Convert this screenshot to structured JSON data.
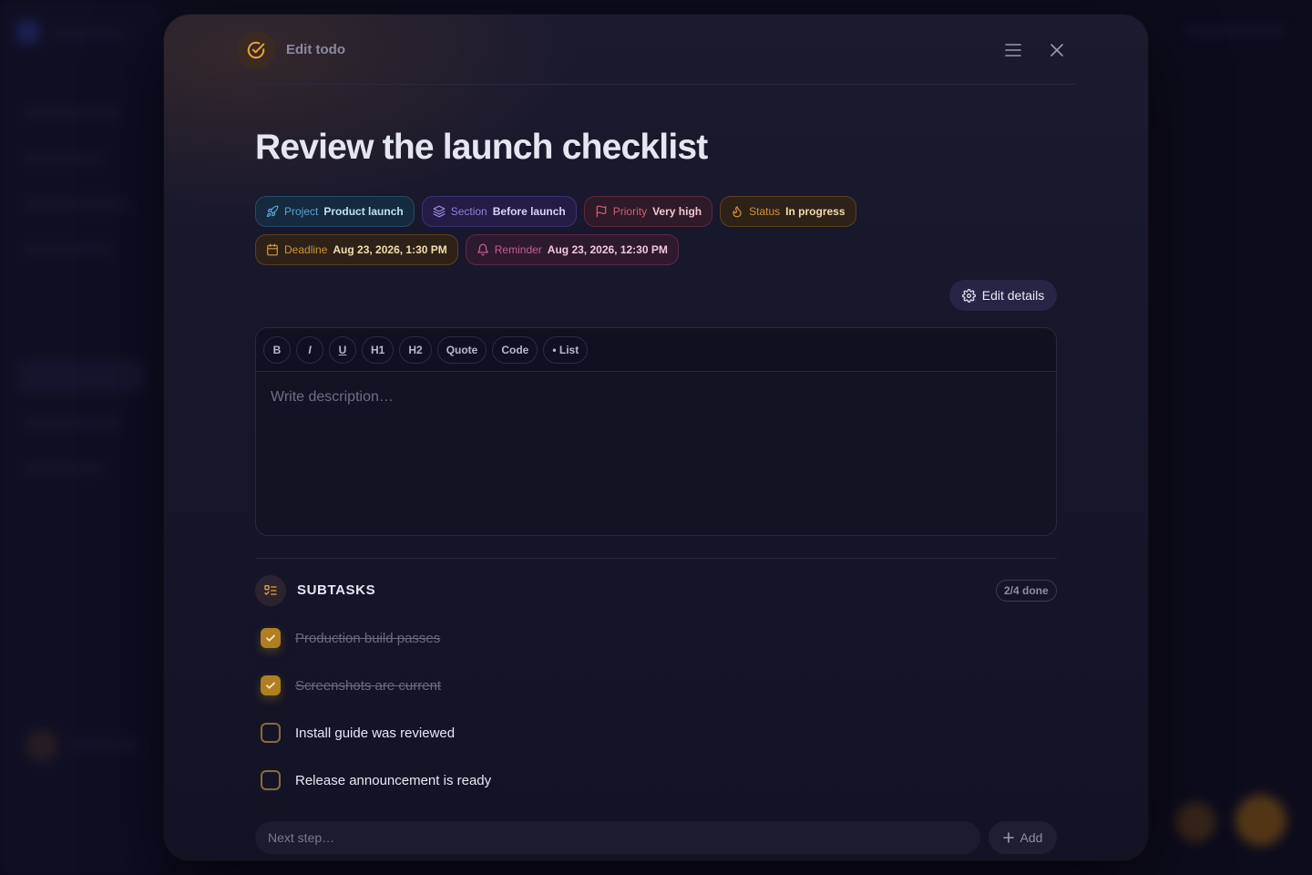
{
  "header": {
    "title": "Edit todo"
  },
  "todo": {
    "title": "Review the launch checklist"
  },
  "chips": {
    "project": {
      "key": "Project",
      "value": "Product launch"
    },
    "section": {
      "key": "Section",
      "value": "Before launch"
    },
    "priority": {
      "key": "Priority",
      "value": "Very high"
    },
    "status": {
      "key": "Status",
      "value": "In progress"
    },
    "deadline": {
      "key": "Deadline",
      "value": "Aug 23, 2026, 1:30 PM"
    },
    "reminder": {
      "key": "Reminder",
      "value": "Aug 23, 2026, 12:30 PM"
    }
  },
  "edit_details_label": "Edit details",
  "editor": {
    "toolbar": [
      "B",
      "I",
      "U",
      "H1",
      "H2",
      "Quote",
      "Code",
      "• List"
    ],
    "placeholder": "Write description…",
    "value": ""
  },
  "subtasks": {
    "title": "SUBTASKS",
    "count": "2/4 done",
    "items": [
      {
        "label": "Production build passes",
        "done": true
      },
      {
        "label": "Screenshots are current",
        "done": true
      },
      {
        "label": "Install guide was reviewed",
        "done": false
      },
      {
        "label": "Release announcement is ready",
        "done": false
      }
    ],
    "input_placeholder": "Next step…",
    "add_label": "Add"
  },
  "colors": {
    "accent": "#d89a3a",
    "project": "#5ea8d8",
    "section": "#9b86e0",
    "priority": "#d9607a",
    "reminder": "#d0609a"
  },
  "icons": {
    "header": "check-circle-icon",
    "menu": "menu-icon",
    "close": "close-icon",
    "project": "rocket-icon",
    "section": "layers-icon",
    "priority": "flag-icon",
    "status": "flame-icon",
    "deadline": "calendar-icon",
    "reminder": "bell-icon",
    "edit_details": "gear-icon",
    "subtasks": "checklist-icon",
    "add": "plus-icon"
  }
}
